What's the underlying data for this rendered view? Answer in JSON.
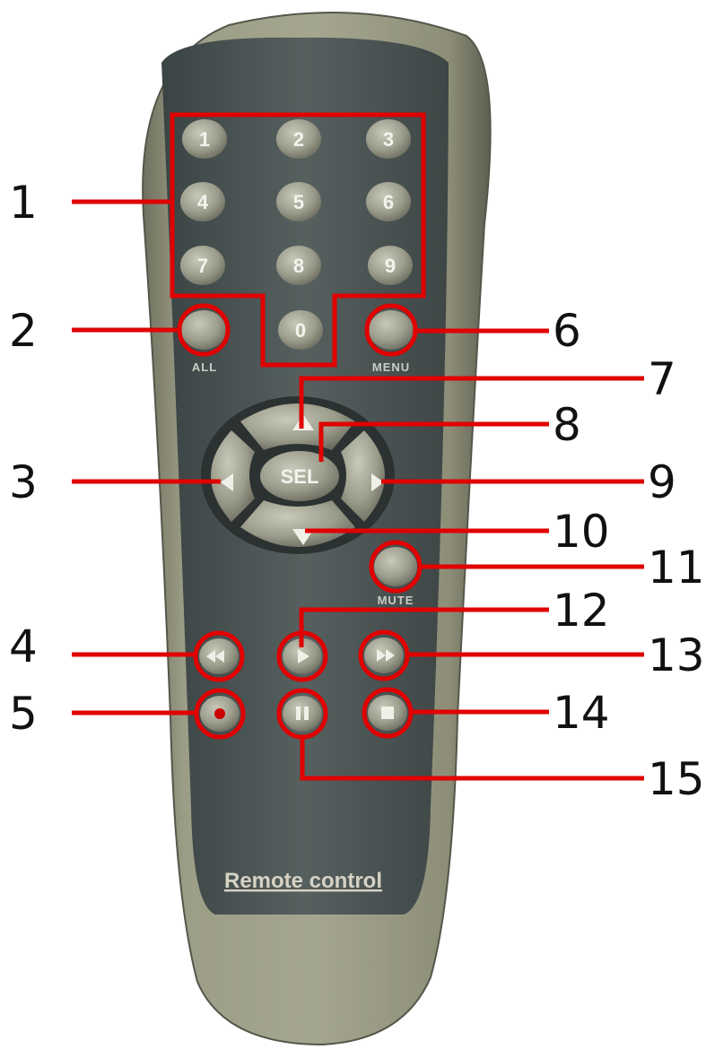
{
  "remote": {
    "brand_text": "Remote control",
    "keypad": [
      "1",
      "2",
      "3",
      "4",
      "5",
      "6",
      "7",
      "8",
      "9",
      "0"
    ],
    "all_label": "ALL",
    "menu_label": "MENU",
    "mute_label": "MUTE",
    "select_label": "SEL"
  },
  "callouts": [
    "1",
    "2",
    "3",
    "4",
    "5",
    "6",
    "7",
    "8",
    "9",
    "10",
    "11",
    "12",
    "13",
    "14",
    "15"
  ],
  "colors": {
    "outline_red": "#e00000",
    "panel": "#4f5a5a",
    "shell": "#8f9078",
    "button": "#a9aa98"
  }
}
